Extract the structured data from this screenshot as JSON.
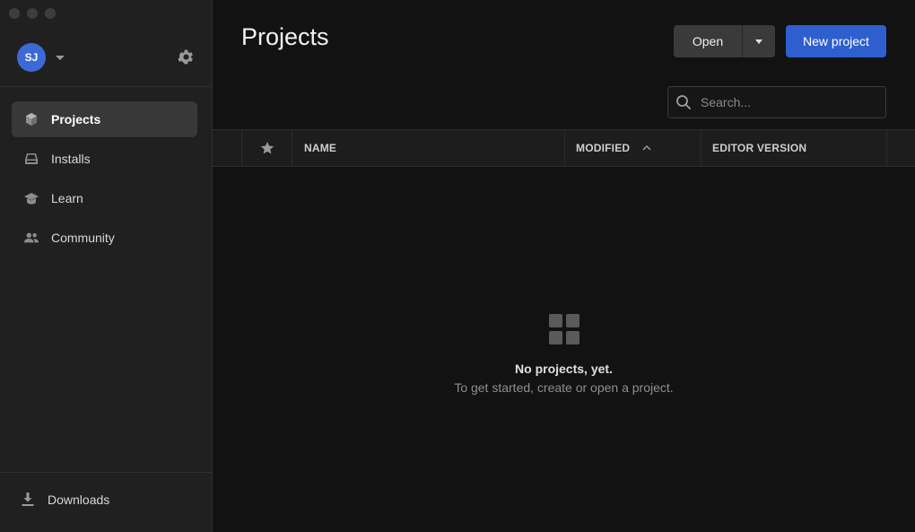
{
  "account": {
    "initials": "SJ",
    "avatar_color": "#3b6ad6"
  },
  "sidebar": {
    "items": [
      {
        "label": "Projects",
        "icon": "cube-icon",
        "active": true
      },
      {
        "label": "Installs",
        "icon": "drive-icon",
        "active": false
      },
      {
        "label": "Learn",
        "icon": "graduation-cap-icon",
        "active": false
      },
      {
        "label": "Community",
        "icon": "people-icon",
        "active": false
      }
    ],
    "downloads_label": "Downloads"
  },
  "main": {
    "title": "Projects",
    "open_label": "Open",
    "new_project_label": "New project",
    "search_placeholder": "Search...",
    "table": {
      "columns": {
        "name": "NAME",
        "modified": "MODIFIED",
        "editor_version": "EDITOR VERSION"
      }
    },
    "empty_state": {
      "title": "No projects, yet.",
      "subtitle": "To get started, create or open a project."
    }
  },
  "colors": {
    "accent": "#2f5fcf",
    "sidebar_bg": "#202020",
    "main_bg": "#121212"
  }
}
